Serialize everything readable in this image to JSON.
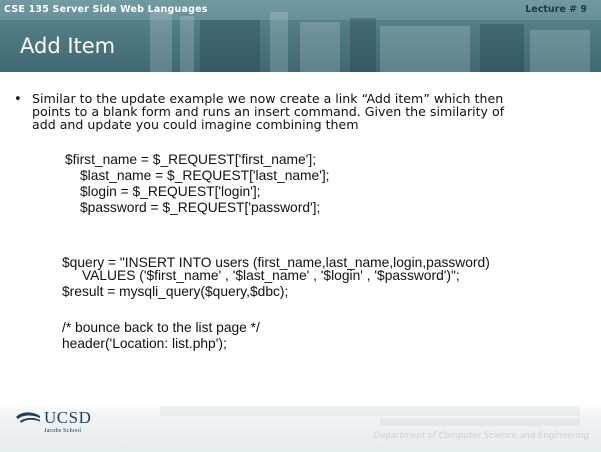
{
  "header": {
    "course": "CSE 135   Server Side Web Languages",
    "lecture": "Lecture # 9",
    "title": "Add Item"
  },
  "bullet": {
    "lines": [
      "Similar to the update example we now create a link “Add item” which then",
      "points to a blank form and runs an insert command. Given the similarity of",
      "add and update you could imagine combining them"
    ]
  },
  "code": {
    "block1": [
      "$first_name = $_REQUEST['first_name'];",
      "$last_name = $_REQUEST['last_name'];",
      "$login = $_REQUEST['login'];",
      "$password = $_REQUEST['password'];"
    ],
    "block2": [
      "$query = \"INSERT INTO users (first_name,last_name,login,password)",
      "VALUES ('$first_name' , '$last_name' , '$login' , '$password')\";",
      "$result = mysqli_query($query,$dbc);"
    ],
    "block3": [
      "/* bounce back to the list page */",
      "header('Location: list.php');"
    ]
  },
  "footer": {
    "logo_text": "UCSD",
    "logo_sub": "Jacobs School",
    "department": "Department of Computer Science and Engineering"
  }
}
